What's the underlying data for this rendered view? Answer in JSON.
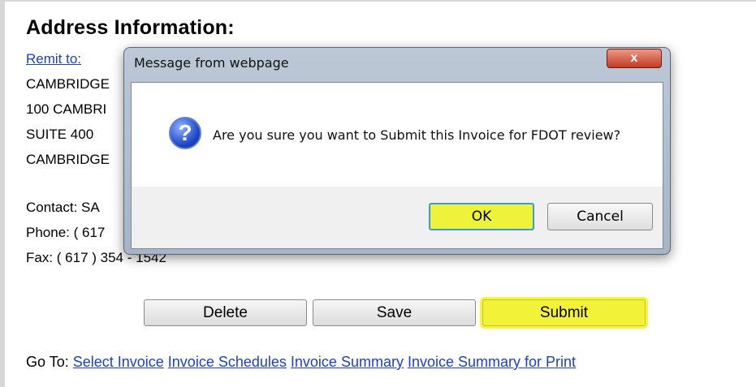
{
  "heading": "Address Information:",
  "remit_link": "Remit to:",
  "address_lines": [
    "CAMBRIDGE",
    "100 CAMBRI",
    "SUITE 400",
    "CAMBRIDGE"
  ],
  "contact": "Contact:  SA",
  "phone": "Phone:  ( 617",
  "fax": "Fax:  ( 617 ) 354 - 1542",
  "buttons": {
    "delete": "Delete",
    "save": "Save",
    "submit": "Submit"
  },
  "goto": {
    "label": "Go To:",
    "links": [
      "Select Invoice",
      "Invoice Schedules",
      "Invoice Summary",
      "Invoice Summary for Print"
    ]
  },
  "dialog": {
    "title": "Message from webpage",
    "close_label": "x",
    "icon": "question-icon",
    "message": "Are you sure you want to Submit this Invoice for FDOT review?",
    "ok_label": "OK",
    "cancel_label": "Cancel"
  },
  "colors": {
    "link": "#1a3fd1",
    "highlight": "#f2f238"
  }
}
